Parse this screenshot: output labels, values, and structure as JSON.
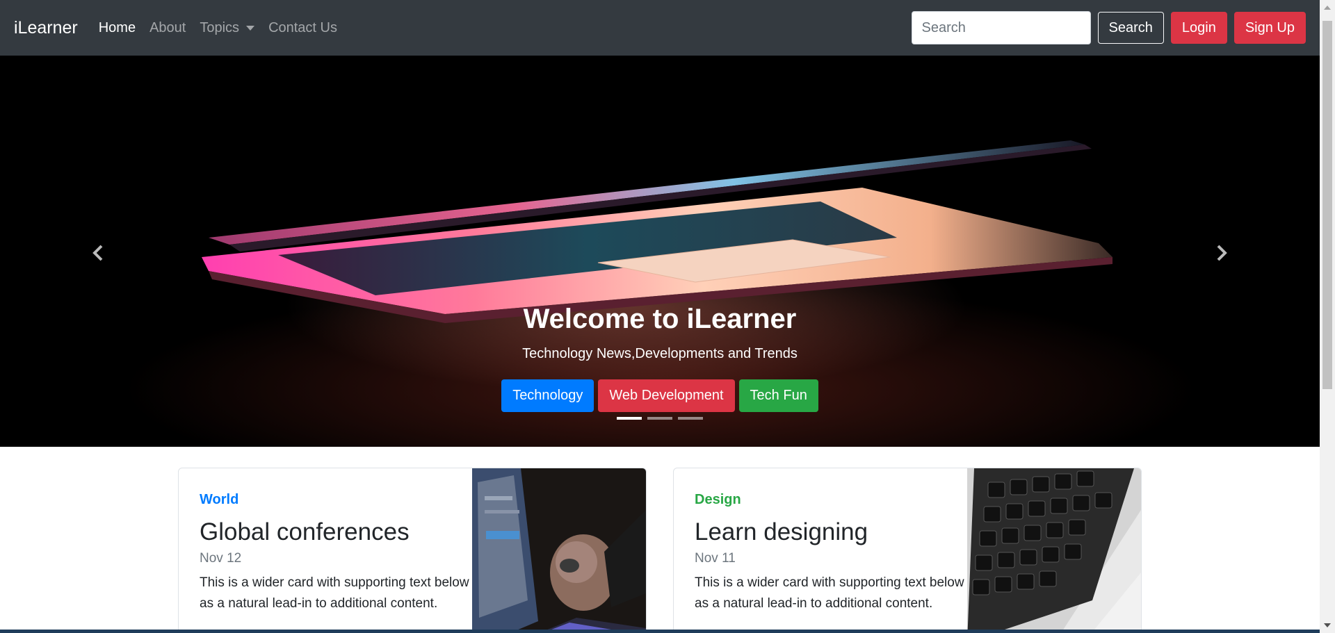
{
  "navbar": {
    "brand": "iLearner",
    "links": [
      {
        "label": "Home"
      },
      {
        "label": "About"
      },
      {
        "label": "Topics"
      },
      {
        "label": "Contact Us"
      }
    ],
    "search_placeholder": "Search",
    "search_button": "Search",
    "login_button": "Login",
    "signup_button": "Sign Up"
  },
  "carousel": {
    "title": "Welcome to iLearner",
    "subtitle": "Technology News,Developments and Trends",
    "buttons": [
      {
        "label": "Technology",
        "color": "#007bff"
      },
      {
        "label": "Web Development",
        "color": "#dc3545"
      },
      {
        "label": "Tech Fun",
        "color": "#28a745"
      }
    ],
    "active_slide": 1,
    "slide_count": 3
  },
  "cards": [
    {
      "category": "World",
      "title": "Global conferences",
      "date": "Nov 12",
      "text": "This is a wider card with supporting text below as a natural lead-in to additional content."
    },
    {
      "category": "Design",
      "title": "Learn designing",
      "date": "Nov 11",
      "text": "This is a wider card with supporting text below as a natural lead-in to additional content."
    }
  ],
  "colors": {
    "navbar_bg": "#343a40",
    "primary": "#007bff",
    "danger": "#dc3545",
    "success": "#28a745"
  }
}
